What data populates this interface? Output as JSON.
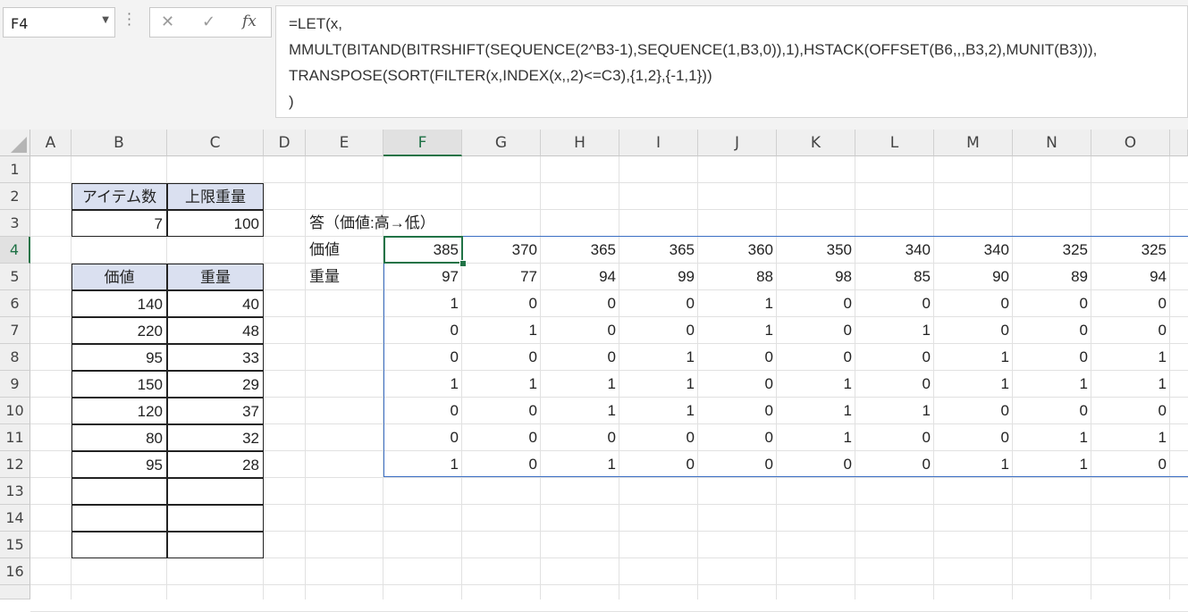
{
  "name_box": {
    "value": "F4"
  },
  "formula_bar": {
    "fx_label": "fx",
    "lines": [
      "=LET(x,",
      "MMULT(BITAND(BITRSHIFT(SEQUENCE(2^B3-1),SEQUENCE(1,B3,0)),1),HSTACK(OFFSET(B6,,,B3,2),MUNIT(B3))),",
      "TRANSPOSE(SORT(FILTER(x,INDEX(x,,2)<=C3),{1,2},{-1,1}))",
      ")"
    ]
  },
  "columns": [
    "A",
    "B",
    "C",
    "D",
    "E",
    "F",
    "G",
    "H",
    "I",
    "J",
    "K",
    "L",
    "M",
    "N",
    "O"
  ],
  "rows": [
    "1",
    "2",
    "3",
    "4",
    "5",
    "6",
    "7",
    "8",
    "9",
    "10",
    "11",
    "12",
    "13",
    "14",
    "15",
    "16"
  ],
  "selected_cell": {
    "column": "F",
    "row": "4"
  },
  "sheet": {
    "B2": "アイテム数",
    "C2": "上限重量",
    "B3": "7",
    "C3": "100",
    "E3": "答（価値:高→低）",
    "E4": "価値",
    "E5": "重量",
    "B5": "価値",
    "C5": "重量",
    "items": [
      [
        "140",
        "40"
      ],
      [
        "220",
        "48"
      ],
      [
        "95",
        "33"
      ],
      [
        "150",
        "29"
      ],
      [
        "120",
        "37"
      ],
      [
        "80",
        "32"
      ],
      [
        "95",
        "28"
      ]
    ],
    "result_rows": [
      [
        "385",
        "370",
        "365",
        "365",
        "360",
        "350",
        "340",
        "340",
        "325",
        "325"
      ],
      [
        "97",
        "77",
        "94",
        "99",
        "88",
        "98",
        "85",
        "90",
        "89",
        "94"
      ],
      [
        "1",
        "0",
        "0",
        "0",
        "1",
        "0",
        "0",
        "0",
        "0",
        "0"
      ],
      [
        "0",
        "1",
        "0",
        "0",
        "1",
        "0",
        "1",
        "0",
        "0",
        "0"
      ],
      [
        "0",
        "0",
        "0",
        "1",
        "0",
        "0",
        "0",
        "1",
        "0",
        "1"
      ],
      [
        "1",
        "1",
        "1",
        "1",
        "0",
        "1",
        "0",
        "1",
        "1",
        "1"
      ],
      [
        "0",
        "0",
        "1",
        "1",
        "0",
        "1",
        "1",
        "0",
        "0",
        "0"
      ],
      [
        "0",
        "0",
        "0",
        "0",
        "0",
        "1",
        "0",
        "0",
        "1",
        "1"
      ],
      [
        "1",
        "0",
        "1",
        "0",
        "0",
        "0",
        "0",
        "1",
        "1",
        "0"
      ]
    ]
  },
  "colors": {
    "header_fill": "#dae0f0",
    "selection_green": "#217346",
    "spill_border": "#3b6fc4"
  }
}
